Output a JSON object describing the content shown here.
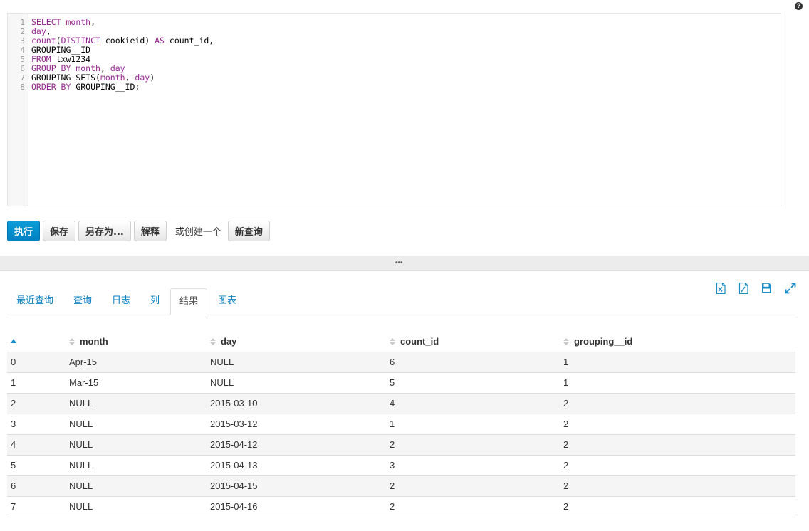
{
  "help_label": "?",
  "editor": {
    "line_numbers": [
      "1",
      "2",
      "3",
      "4",
      "5",
      "6",
      "7",
      "8"
    ],
    "lines": [
      [
        {
          "t": "SELECT",
          "kw": true
        },
        {
          "t": " "
        },
        {
          "t": "month",
          "kw": true
        },
        {
          "t": ","
        }
      ],
      [
        {
          "t": "day",
          "kw": true
        },
        {
          "t": ","
        }
      ],
      [
        {
          "t": "count",
          "kw": true
        },
        {
          "t": "("
        },
        {
          "t": "DISTINCT",
          "kw": true
        },
        {
          "t": " cookieid) "
        },
        {
          "t": "AS",
          "kw": true
        },
        {
          "t": " count_id,"
        }
      ],
      [
        {
          "t": "GROUPING__ID"
        }
      ],
      [
        {
          "t": "FROM",
          "kw": true
        },
        {
          "t": " lxw1234"
        }
      ],
      [
        {
          "t": "GROUP BY",
          "kw": true
        },
        {
          "t": " "
        },
        {
          "t": "month",
          "kw": true
        },
        {
          "t": ", "
        },
        {
          "t": "day",
          "kw": true
        }
      ],
      [
        {
          "t": "GROUPING SETS("
        },
        {
          "t": "month",
          "kw": true
        },
        {
          "t": ", "
        },
        {
          "t": "day",
          "kw": true
        },
        {
          "t": ")"
        }
      ],
      [
        {
          "t": "ORDER BY",
          "kw": true
        },
        {
          "t": " GROUPING__ID;"
        }
      ]
    ]
  },
  "actions": {
    "execute": "执行",
    "save": "保存",
    "save_as": "另存为...",
    "explain": "解释",
    "or_create": "或创建一个",
    "new_query": "新查询"
  },
  "divider_grip": "•••",
  "tabs": {
    "recent": "最近查询",
    "query": "查询",
    "log": "日志",
    "columns": "列",
    "results": "结果",
    "chart": "图表"
  },
  "colors": {
    "primary": "#0b8fcf",
    "link": "#0a81c2",
    "keyword": "#93268f"
  },
  "toolbar_icons": [
    "excel-icon",
    "csv-icon",
    "save-icon",
    "fullscreen-icon"
  ],
  "results": {
    "columns": [
      "",
      "month",
      "day",
      "count_id",
      "grouping__id"
    ],
    "rows": [
      [
        "0",
        "Apr-15",
        "NULL",
        "6",
        "1"
      ],
      [
        "1",
        "Mar-15",
        "NULL",
        "5",
        "1"
      ],
      [
        "2",
        "NULL",
        "2015-03-10",
        "4",
        "2"
      ],
      [
        "3",
        "NULL",
        "2015-03-12",
        "1",
        "2"
      ],
      [
        "4",
        "NULL",
        "2015-04-12",
        "2",
        "2"
      ],
      [
        "5",
        "NULL",
        "2015-04-13",
        "3",
        "2"
      ],
      [
        "6",
        "NULL",
        "2015-04-15",
        "2",
        "2"
      ],
      [
        "7",
        "NULL",
        "2015-04-16",
        "2",
        "2"
      ]
    ]
  }
}
